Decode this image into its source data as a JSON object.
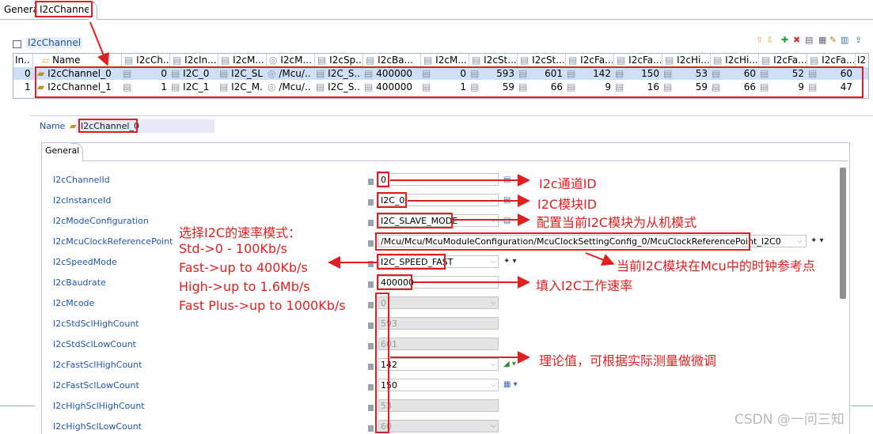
{
  "tabs": [
    {
      "label": "General"
    },
    {
      "label": "I2cChannel"
    }
  ],
  "section_title": "I2cChannel",
  "table": {
    "columns": [
      "In...",
      "Name",
      "I2cCh...",
      "I2cIn...",
      "I2cM...",
      "I2cM...",
      "I2cSp...",
      "I2cBa...",
      "I2cM...",
      "I2cSt...",
      "I2cSt...",
      "I2cFa...",
      "I2cFa...",
      "I2cHi...",
      "I2cHi...",
      "I2cFa...",
      "I2cFa...",
      "I2"
    ],
    "rows": [
      {
        "index": "0",
        "name": "I2cChannel_0",
        "ch": "0",
        "inst": "I2C_0",
        "mode": "I2C_SL...",
        "clk": "/Mcu/...",
        "speed": "I2C_S...",
        "baud": "400000",
        "mcode": "0",
        "std_h": "593",
        "std_l": "601",
        "fast_h": "142",
        "fast_l": "150",
        "hi_h": "53",
        "hi_l": "60",
        "fp_h": "52",
        "fp_l": "60"
      },
      {
        "index": "1",
        "name": "I2cChannel_1",
        "ch": "1",
        "inst": "I2C_1",
        "mode": "I2C_M...",
        "clk": "/Mcu/...",
        "speed": "I2C_S...",
        "baud": "400000",
        "mcode": "1",
        "std_h": "59",
        "std_l": "66",
        "fast_h": "9",
        "fast_l": "16",
        "hi_h": "59",
        "hi_l": "66",
        "fp_h": "9",
        "fp_l": "47"
      }
    ]
  },
  "detail": {
    "name_label": "Name",
    "name_value": "I2cChannel_0",
    "tab_label": "General",
    "properties": [
      {
        "label": "I2cChannelId",
        "value": "0",
        "disabled": false
      },
      {
        "label": "I2cInstanceId",
        "value": "I2C_0",
        "disabled": false
      },
      {
        "label": "I2cModeConfiguration",
        "value": "I2C_SLAVE_MODE",
        "disabled": false
      },
      {
        "label": "I2cMcuClockReferencePoint",
        "value": "/Mcu/Mcu/McuModuleConfiguration/McuClockSettingConfig_0/McuClockReferencePoint_I2C0",
        "disabled": false
      },
      {
        "label": "I2cSpeedMode",
        "value": "I2C_SPEED_FAST",
        "disabled": false
      },
      {
        "label": "I2cBaudrate",
        "value": "400000",
        "disabled": false
      },
      {
        "label": "I2cMcode",
        "value": "0",
        "disabled": true
      },
      {
        "label": "I2cStdSclHighCount",
        "value": "593",
        "disabled": true
      },
      {
        "label": "I2cStdSclLowCount",
        "value": "601",
        "disabled": true
      },
      {
        "label": "I2cFastSclHighCount",
        "value": "142",
        "disabled": false
      },
      {
        "label": "I2cFastSclLowCount",
        "value": "150",
        "disabled": false
      },
      {
        "label": "I2cHighSclHighCount",
        "value": "53",
        "disabled": true
      },
      {
        "label": "I2cHighSclLowCount",
        "value": "60",
        "disabled": true
      }
    ]
  },
  "annotations": {
    "channel_id": "I2c通道ID",
    "module_id": "I2C模块ID",
    "slave_mode": "配置当前I2C模块为从机模式",
    "clock_ref": "当前I2C模块在Mcu中的时钟参考点",
    "baud": "填入I2C工作速率",
    "theory": "理论值，可根据实际测量做微调",
    "speed_title": "选择I2C的速率模式：",
    "speed_std": "Std->0 - 100Kb/s",
    "speed_fast": "Fast->up to 400Kb/s",
    "speed_high": "High->up to 1.6Mb/s",
    "speed_fastplus": "Fast Plus->up to 1000Kb/s"
  },
  "watermark": "CSDN @一问三知",
  "colors": {
    "annotation": "#e02020",
    "link": "#1f56a8",
    "selected_row": "#cfe0f6"
  }
}
